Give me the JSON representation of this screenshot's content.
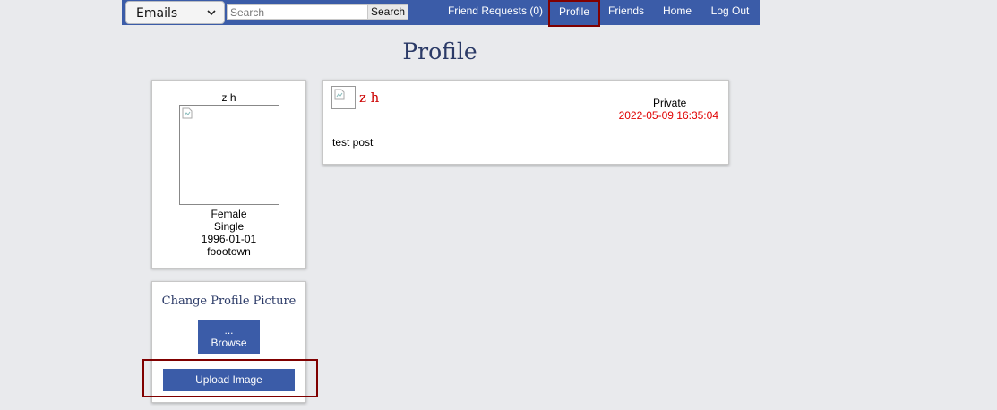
{
  "navbar": {
    "dropdown_value": "Emails",
    "search_placeholder": "Search",
    "search_button": "Search",
    "links": [
      {
        "label": "Friend Requests (0)",
        "active": false
      },
      {
        "label": "Profile",
        "active": true
      },
      {
        "label": "Friends",
        "active": false
      },
      {
        "label": "Home",
        "active": false
      },
      {
        "label": "Log Out",
        "active": false
      }
    ]
  },
  "page": {
    "title": "Profile"
  },
  "profile": {
    "name": "z h",
    "gender": "Female",
    "status": "Single",
    "birthdate": "1996-01-01",
    "hometown": "foootown"
  },
  "change_picture": {
    "title": "Change Profile Picture",
    "browse_dots": "...",
    "browse_label": "Browse",
    "upload_label": "Upload Image"
  },
  "post": {
    "author": "z h",
    "privacy": "Private",
    "date": "2022-05-09 16:35:04",
    "text": "test post"
  },
  "colors": {
    "navbar": "#3b5ca8",
    "highlight_border": "#800000",
    "author_red": "#cc0000",
    "date_red": "#e00000",
    "title_navy": "#2b3a67"
  }
}
